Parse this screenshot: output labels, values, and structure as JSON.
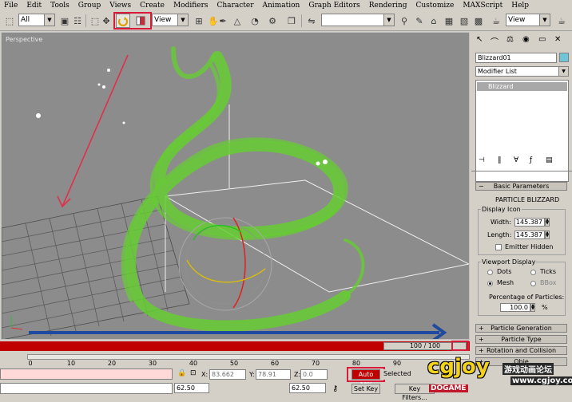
{
  "menu": [
    "File",
    "Edit",
    "Tools",
    "Group",
    "Views",
    "Create",
    "Modifiers",
    "Character",
    "Animation",
    "Graph Editors",
    "Rendering",
    "Customize",
    "MAXScript",
    "Help"
  ],
  "toolbar": {
    "selection_filter": "All",
    "ref_coord": "View",
    "ref_coord_right": "View"
  },
  "viewport": {
    "label": "Perspective"
  },
  "panel": {
    "object_name": "Blizzard01",
    "modifier_list": "Modifier List",
    "stack_item": "Blizzard",
    "rollout_basic": "Basic Parameters",
    "section_title": "PARTICLE BLIZZARD",
    "display_icon": "Display Icon",
    "width_label": "Width:",
    "width_value": "145.387",
    "length_label": "Length:",
    "length_value": "145.387",
    "emitter_hidden": "Emitter Hidden",
    "viewport_display": "Viewport Display",
    "dots": "Dots",
    "ticks": "Ticks",
    "mesh": "Mesh",
    "bbox": "BBox",
    "percentage_label": "Percentage of Particles:",
    "percentage_value": "100.0",
    "percent_sign": "%",
    "rollout_generation": "Particle Generation",
    "rollout_type": "Particle Type",
    "rollout_rotation": "Rotation and Collision",
    "rollout_last": "Obje"
  },
  "timeline": {
    "frame_counter": "100 / 100",
    "ticks": [
      "0",
      "10",
      "20",
      "30",
      "40",
      "50",
      "60",
      "70",
      "80",
      "90"
    ]
  },
  "status": {
    "x_label": "X:",
    "x_value": "83.662",
    "y_label": "Y:",
    "y_value": "78.91",
    "z_label": "Z:",
    "z_value": "0.0",
    "auto_key": "Auto Key",
    "selected": "Selected",
    "set_key": "Set Key",
    "key_filters": "Key Filters...",
    "readout_left": "62.50",
    "readout_mid": "62.50"
  },
  "watermark": {
    "logo": "cgjoy",
    "chinese": "游戏动画论坛",
    "url": "www.cgjoy.com",
    "dogame": "DOGAME"
  },
  "colors": {
    "accent_red": "#d81b3a",
    "particle_green": "#66cc33",
    "arrow_blue": "#1f4aa0"
  }
}
